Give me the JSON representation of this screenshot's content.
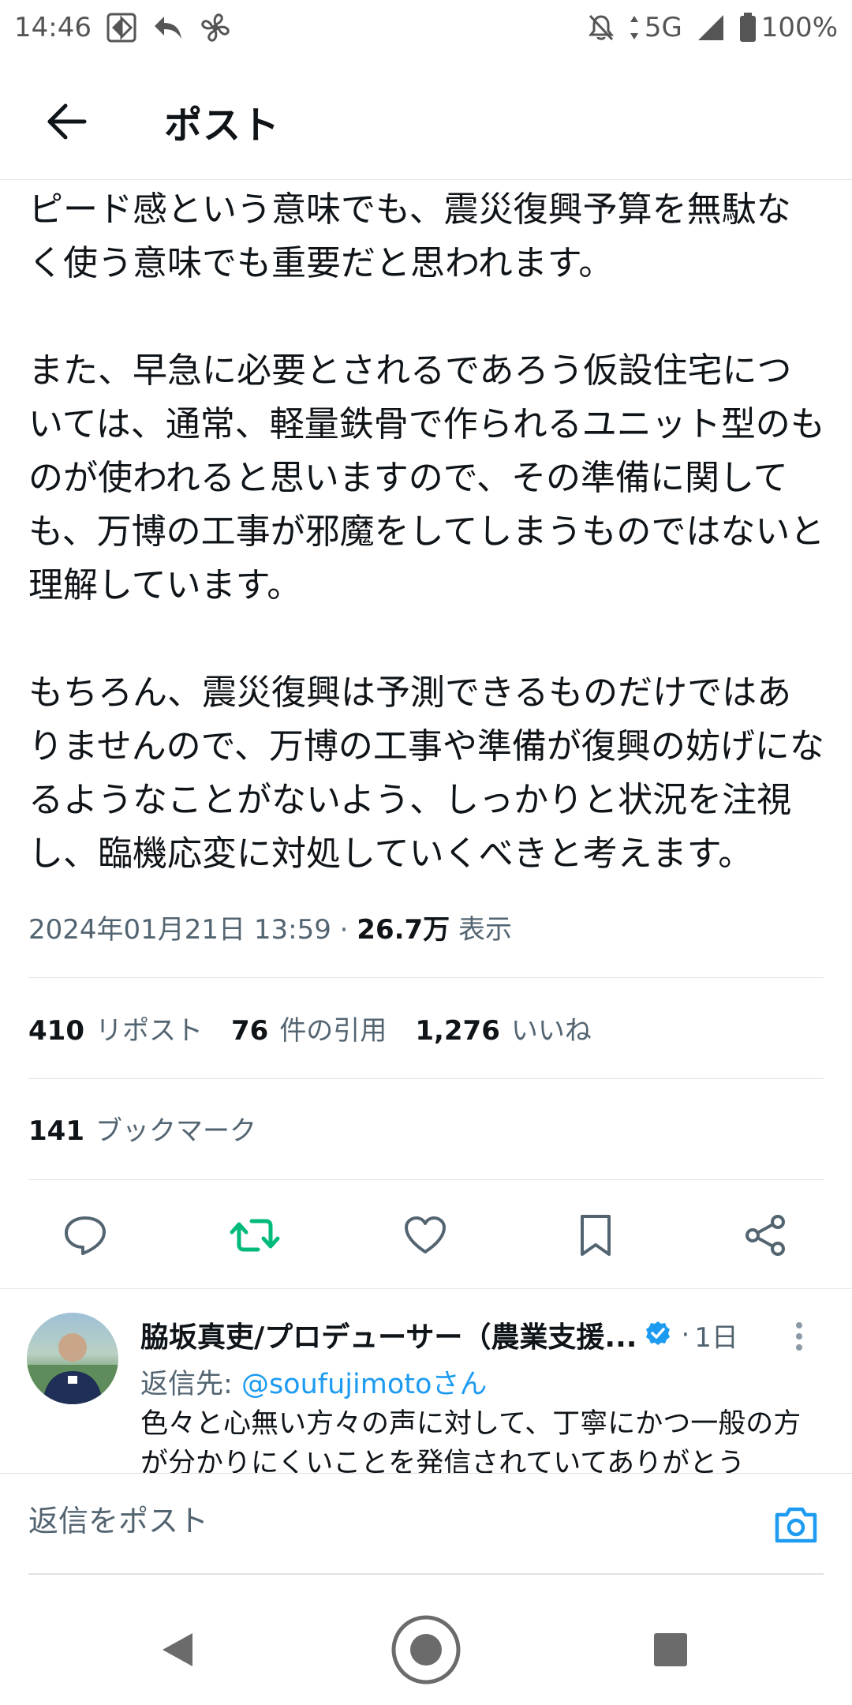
{
  "status_bar": {
    "time": "14:46",
    "network": "5G",
    "battery": "100%"
  },
  "header": {
    "title": "ポスト"
  },
  "tweet": {
    "paragraphs": [
      "ピード感という意味でも、震災復興予算を無駄なく使う意味でも重要だと思われます。",
      "また、早急に必要とされるであろう仮設住宅については、通常、軽量鉄骨で作られるユニット型のものが使われると思いますので、その準備に関しても、万博の工事が邪魔をしてしまうものではないと理解しています。",
      "もちろん、震災復興は予測できるものだけではありませんので、万博の工事や準備が復興の妨げになるようなことがないよう、しっかりと状況を注視し、臨機応変に対処していくべきと考えます。"
    ],
    "timestamp": "2024年01月21日 13:59",
    "separator": "·",
    "views": "26.7万",
    "views_label": "表示"
  },
  "stats": {
    "reposts": "410",
    "reposts_label": "リポスト",
    "quotes": "76",
    "quotes_label": "件の引用",
    "likes": "1,276",
    "likes_label": "いいね",
    "bookmarks": "141",
    "bookmarks_label": "ブックマーク"
  },
  "actions": {
    "reply_icon": "speech-bubble-icon",
    "repost_icon": "repost-icon",
    "like_icon": "heart-icon",
    "bookmark_icon": "bookmark-icon",
    "share_icon": "share-icon",
    "repost_color": "#00ba7c"
  },
  "reply": {
    "name": "脇坂真吏/プロデューサー（農業支援...",
    "time_sep": "·",
    "time": "1日",
    "reply_to_label": "返信先:",
    "reply_to_handle": "@soufujimotoさん",
    "text": "色々と心無い方々の声に対して、丁寧にかつ一般の方が分かりにくいことを発信されていてありがとう"
  },
  "composer": {
    "placeholder": "返信をポスト"
  },
  "colors": {
    "accent": "#1d9bf0",
    "text_primary": "#0f1419",
    "text_secondary": "#536471"
  }
}
